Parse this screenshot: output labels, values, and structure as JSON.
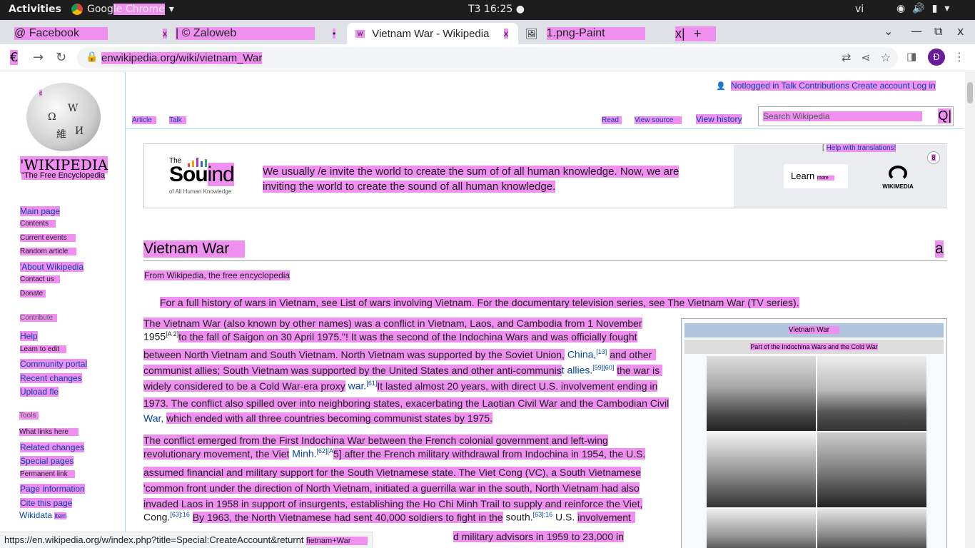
{
  "gnome": {
    "activities": "Activities",
    "app_name_a": "Goog",
    "app_name_b": "le Chrome",
    "clock": "T3 16:25",
    "lang": "vi"
  },
  "tabs": [
    {
      "label": "@ Facebook",
      "close": "x"
    },
    {
      "label": "| © Zaloweb",
      "close": "•"
    },
    {
      "label": "Vietnam War - Wikipedia",
      "favicon": "w",
      "close": "x"
    },
    {
      "label": "1.png-Paint",
      "close": "x|",
      "new": "+"
    }
  ],
  "browser": {
    "back": "€",
    "url": "enwikipedia.org/wiki/vietnam_War",
    "profile": "Đ"
  },
  "wiki": {
    "wordmark": "'WIKIPEDIA",
    "tagline": "\"The Free Encyclopedia",
    "user_links": "Notlogged in Talk Contributions Create account Log in",
    "tab_article": "Article",
    "tab_talk": "Talk",
    "tab_read": "Read",
    "tab_view_source": "View source",
    "tab_view_history": "View history",
    "search_placeholder": "Search Wikipedia",
    "search_icon": "Q|",
    "sidebar": {
      "main_page": "Main page",
      "contents": "Contents",
      "current_events": "Current events",
      "random_article": "Random article",
      "about": "'About Wikipedia",
      "contact": "Contact us",
      "donate": "Donate",
      "contribute": "Contribute",
      "help": "Help",
      "learn_to_edit": "Leam to edit",
      "community_portal": "Community portal",
      "recent_changes": "Recent changes",
      "upload_file": "Upload fle",
      "tools": "Tools",
      "what_links_here": "What links here",
      "related_changes": "Related changes",
      "special_pages": "Special pages",
      "permanent_link": "Permanent link",
      "page_information": "Page information",
      "cite_this_page": "Cite this page",
      "wikidata": "Wikidata",
      "wikidata_item": "item"
    },
    "banner": {
      "logo_the": "The",
      "logo_word_a": "Sou",
      "logo_word_b": "ind",
      "logo_sub": "of All Human Knowledge",
      "text": "We usually /e invite the world to create the sum of of all human knowledge. Now, we are inviting the world to create the sound of all human knowledge.",
      "learn_label": "Learn",
      "learn_more": "more",
      "help_translate": "Help with translations!",
      "close": "8",
      "wikimedia": "WIKIMEDIA"
    },
    "title": "Vietnam War",
    "title_icon": "a",
    "from": "From Wikipedia, the free encyclopedia",
    "hatnote": "For a full history of wars in Vietnam, see List of wars involving Vietnam. For the documentary television series, see The Vietnam War (TV series).",
    "p1": [
      "The Vietnam War (also known by other names) was a conflict in Vietnam, Laos, and Cambodia from 1 November",
      "1955",
      "[A 2]",
      "to the fall of Saigon on 30 April 1975.\"! It was the second of the Indochina Wars and was officially fought",
      "between North Vietnam and South Vietnam. North Vietnam was supported by the Soviet Union,",
      "China,",
      "[13]",
      "and other",
      "communist allies; South Vietnam was supported by the United States and other anti-communis",
      "t allies.",
      "[59][60]",
      "the war is",
      "widely considered to be a Cold War-era proxy",
      "war.",
      "[61]",
      "It lasted almost 20 years, with direct U.S. involvement ending in",
      "1973. The conflict also spilled over into neighboring states, exacerbating the Laotian Civil War and the Cambodian Civil",
      "War,",
      "which ended with all three countries becoming communist states by 1975."
    ],
    "p2": [
      "The conflict emerged from the First Indochina War between the French colonial government and left-wing",
      "revolutionary movement, the Viet",
      "Minh.",
      "[62][A",
      "5] after the French military withdrawal from Indochina in 1954, the U.S.",
      "assumed financial and military support for the South Vietnamese state. The Viet Cong (VC), a South Vietnamese",
      "'common front under the direction of North Vietnam, initiated a guerrilla war in the south, North Vietnam had also",
      "invaded Laos in 1958 in support of insurgents, establishing the Ho Chi Minh Trail to supply and reinforce the Viet,",
      "Cong.",
      "[63]:16",
      "By 1963, the North Vietnamese had sent 40,000 soldiers to fight in the",
      "south.",
      "[63]:16",
      "U.S.",
      "involvement",
      "d military advisors in 1959 to 23,000 in"
    ],
    "infobox": {
      "title": "Vietnam War",
      "subtitle": "Part of the Indochina Wars and the Cold War"
    }
  },
  "status_url": "https://en.wikipedia.org/w/index.php?title=Special:CreateAccount&returnt",
  "status_url_tail": "fietnam+War"
}
